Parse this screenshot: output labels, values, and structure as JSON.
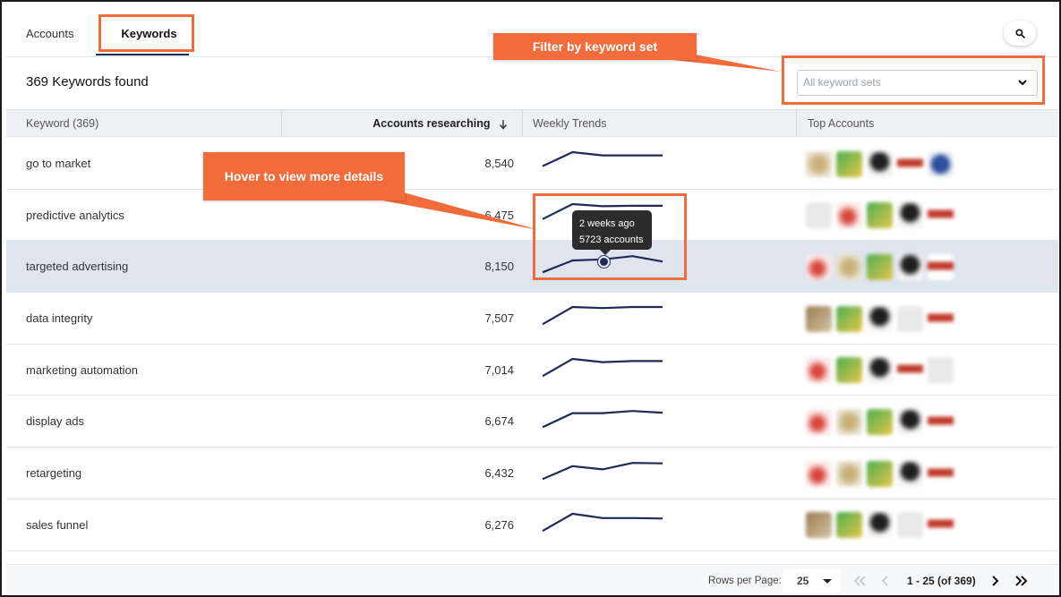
{
  "tabs": [
    {
      "label": "Accounts",
      "active": false
    },
    {
      "label": "Keywords",
      "active": true
    }
  ],
  "summary": {
    "title": "369 Keywords found"
  },
  "filter": {
    "placeholder": "All keyword sets"
  },
  "table": {
    "columns": {
      "keyword": "Keyword (369)",
      "accounts": "Accounts researching",
      "trends": "Weekly Trends",
      "top": "Top Accounts"
    },
    "rows": [
      {
        "keyword": "go to market",
        "accounts": "8,540",
        "trend": [
          0.35,
          1.0,
          0.85,
          0.85,
          0.85
        ],
        "logos": [
          "gold",
          "green",
          "amazon",
          "red",
          "fb"
        ]
      },
      {
        "keyword": "predictive analytics",
        "accounts": "6,475",
        "trend": [
          0.3,
          1.0,
          0.9,
          0.92,
          0.92
        ],
        "logos": [
          "light",
          "d",
          "green",
          "amazon",
          "red"
        ]
      },
      {
        "keyword": "targeted advertising",
        "accounts": "8,150",
        "trend": [
          0.2,
          0.75,
          0.8,
          0.95,
          0.7
        ],
        "logos": [
          "d",
          "gold",
          "green",
          "amazon",
          "red"
        ],
        "highlighted": true
      },
      {
        "keyword": "data integrity",
        "accounts": "7,507",
        "trend": [
          0.2,
          1.0,
          0.95,
          1.0,
          1.0
        ],
        "logos": [
          "tan",
          "green",
          "amazon",
          "light",
          "red"
        ]
      },
      {
        "keyword": "marketing automation",
        "accounts": "7,014",
        "trend": [
          0.2,
          1.0,
          0.85,
          0.9,
          0.9
        ],
        "logos": [
          "d",
          "green",
          "amazon",
          "red",
          "light"
        ]
      },
      {
        "keyword": "display ads",
        "accounts": "6,674",
        "trend": [
          0.2,
          0.85,
          0.85,
          0.95,
          0.87
        ],
        "logos": [
          "d",
          "gold",
          "green",
          "amazon",
          "red"
        ]
      },
      {
        "keyword": "retargeting",
        "accounts": "6,432",
        "trend": [
          0.2,
          0.8,
          0.65,
          0.95,
          0.93
        ],
        "logos": [
          "d",
          "gold",
          "green",
          "amazon",
          "red"
        ]
      },
      {
        "keyword": "sales funnel",
        "accounts": "6,276",
        "trend": [
          0.2,
          1.0,
          0.8,
          0.8,
          0.78
        ],
        "logos": [
          "tan",
          "green",
          "amazon",
          "light",
          "red"
        ]
      }
    ]
  },
  "tooltip": {
    "line1": "2 weeks ago",
    "line2": "5723 accounts"
  },
  "pagination": {
    "rows_per_page_label": "Rows per Page:",
    "rows_per_page": "25",
    "range": "1 - 25 (of 369)"
  },
  "callouts": {
    "filter": "Filter by keyword set",
    "hover": "Hover to view more details"
  },
  "colors": {
    "accent": "#f26b3a",
    "trend_line": "#1f2a55",
    "highlight_row": "#dfe5ee"
  }
}
